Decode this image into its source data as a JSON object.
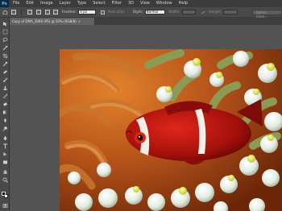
{
  "app": {
    "logo": "Ps"
  },
  "menu": {
    "items": [
      "File",
      "Edit",
      "Image",
      "Layer",
      "Type",
      "Select",
      "Filter",
      "3D",
      "View",
      "Window",
      "Help"
    ]
  },
  "options": {
    "feather_label": "Feather:",
    "feather_value": "0 px",
    "antialias_label": "Anti-alias",
    "style_label": "Style:",
    "style_value": "Normal",
    "width_label": "Width:",
    "height_label": "Height:",
    "refine_label": "Refine Edge..."
  },
  "document": {
    "tab_title": "Copy of DMA_2006 (PS) @ 50% (RGB/8)",
    "close_glyph": "×"
  },
  "toolbox": {
    "tools": [
      "move",
      "marquee",
      "lasso",
      "quick-select",
      "crop",
      "eyedropper",
      "spot-heal",
      "brush",
      "clone-stamp",
      "history-brush",
      "eraser",
      "gradient",
      "blur",
      "dodge",
      "pen",
      "type",
      "path-select",
      "shape",
      "hand",
      "zoom"
    ]
  },
  "colors": {
    "foreground": "#000000",
    "background": "#ffffff"
  }
}
